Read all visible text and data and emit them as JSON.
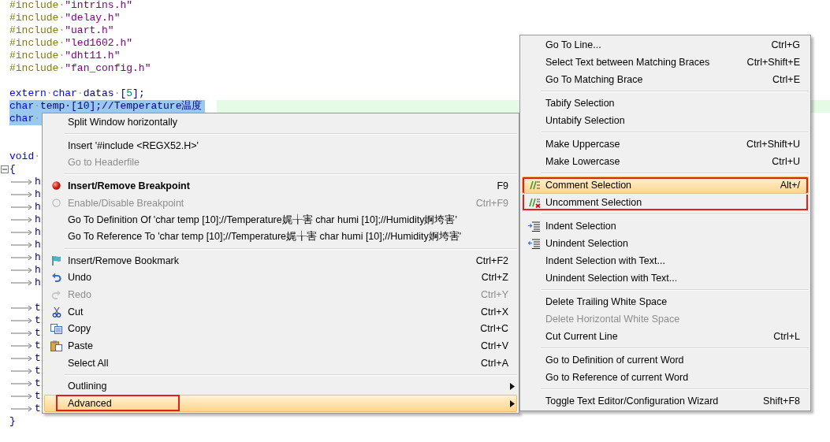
{
  "editor": {
    "lines": [
      {
        "kind": "code",
        "tokens": [
          {
            "kind": "directive",
            "text": "#include"
          },
          {
            "kind": "space",
            "text": "·"
          },
          {
            "kind": "string",
            "text": "\"intrins.h\""
          }
        ]
      },
      {
        "kind": "code",
        "tokens": [
          {
            "kind": "directive",
            "text": "#include"
          },
          {
            "kind": "space",
            "text": "·"
          },
          {
            "kind": "string",
            "text": "\"delay.h\""
          }
        ]
      },
      {
        "kind": "code",
        "tokens": [
          {
            "kind": "directive",
            "text": "#include"
          },
          {
            "kind": "space",
            "text": "·"
          },
          {
            "kind": "string",
            "text": "\"uart.h\""
          }
        ]
      },
      {
        "kind": "code",
        "tokens": [
          {
            "kind": "directive",
            "text": "#include"
          },
          {
            "kind": "space",
            "text": "·"
          },
          {
            "kind": "string",
            "text": "\"led1602.h\""
          }
        ]
      },
      {
        "kind": "code",
        "tokens": [
          {
            "kind": "directive",
            "text": "#include"
          },
          {
            "kind": "space",
            "text": "·"
          },
          {
            "kind": "string",
            "text": "\"dht11.h\""
          }
        ]
      },
      {
        "kind": "code",
        "tokens": [
          {
            "kind": "directive",
            "text": "#include"
          },
          {
            "kind": "space",
            "text": "·"
          },
          {
            "kind": "string",
            "text": "\"fan_config.h\""
          }
        ]
      },
      {
        "kind": "blank"
      },
      {
        "kind": "code",
        "tokens": [
          {
            "kind": "keyword",
            "text": "extern"
          },
          {
            "kind": "space",
            "text": "·"
          },
          {
            "kind": "keyword",
            "text": "char"
          },
          {
            "kind": "space",
            "text": "·"
          },
          {
            "kind": "plain",
            "text": "datas"
          },
          {
            "kind": "space",
            "text": "·"
          },
          {
            "kind": "plain",
            "text": "["
          },
          {
            "kind": "number",
            "text": "5"
          },
          {
            "kind": "plain",
            "text": "];"
          }
        ]
      },
      {
        "kind": "code",
        "selected": true,
        "current": true,
        "tokens": [
          {
            "kind": "keyword",
            "text": "char"
          },
          {
            "kind": "space",
            "text": "·"
          },
          {
            "kind": "plain",
            "text": "temp·[10];//Temperature温度"
          }
        ]
      },
      {
        "kind": "code",
        "selected": true,
        "tokens": [
          {
            "kind": "keyword",
            "text": "char"
          },
          {
            "kind": "space",
            "text": "·"
          }
        ]
      },
      {
        "kind": "blank"
      },
      {
        "kind": "blank"
      },
      {
        "kind": "code",
        "tokens": [
          {
            "kind": "keyword",
            "text": "void"
          },
          {
            "kind": "space",
            "text": "·"
          }
        ]
      },
      {
        "kind": "code",
        "fold_marker": true,
        "tokens": [
          {
            "kind": "plain",
            "text": "{"
          }
        ]
      },
      {
        "kind": "code",
        "tokens": [
          {
            "kind": "tab"
          },
          {
            "kind": "plain",
            "text": "h"
          }
        ]
      },
      {
        "kind": "code",
        "tokens": [
          {
            "kind": "tab"
          },
          {
            "kind": "plain",
            "text": "h"
          }
        ]
      },
      {
        "kind": "code",
        "tokens": [
          {
            "kind": "tab"
          },
          {
            "kind": "plain",
            "text": "h"
          }
        ]
      },
      {
        "kind": "code",
        "tokens": [
          {
            "kind": "tab"
          },
          {
            "kind": "plain",
            "text": "h"
          }
        ]
      },
      {
        "kind": "code",
        "tokens": [
          {
            "kind": "tab"
          },
          {
            "kind": "plain",
            "text": "h"
          }
        ]
      },
      {
        "kind": "code",
        "tokens": [
          {
            "kind": "tab"
          },
          {
            "kind": "plain",
            "text": "h"
          }
        ]
      },
      {
        "kind": "code",
        "tokens": [
          {
            "kind": "tab"
          },
          {
            "kind": "plain",
            "text": "h"
          }
        ]
      },
      {
        "kind": "code",
        "tokens": [
          {
            "kind": "tab"
          },
          {
            "kind": "plain",
            "text": "h"
          }
        ]
      },
      {
        "kind": "code",
        "tokens": [
          {
            "kind": "tab"
          },
          {
            "kind": "plain",
            "text": "h"
          }
        ]
      },
      {
        "kind": "blank"
      },
      {
        "kind": "code",
        "tokens": [
          {
            "kind": "tab"
          },
          {
            "kind": "plain",
            "text": "t"
          }
        ]
      },
      {
        "kind": "code",
        "tokens": [
          {
            "kind": "tab"
          },
          {
            "kind": "plain",
            "text": "t"
          }
        ]
      },
      {
        "kind": "code",
        "tokens": [
          {
            "kind": "tab"
          },
          {
            "kind": "plain",
            "text": "t"
          }
        ]
      },
      {
        "kind": "code",
        "tokens": [
          {
            "kind": "tab"
          },
          {
            "kind": "plain",
            "text": "t"
          }
        ]
      },
      {
        "kind": "code",
        "tokens": [
          {
            "kind": "tab"
          },
          {
            "kind": "plain",
            "text": "t"
          }
        ]
      },
      {
        "kind": "code",
        "tokens": [
          {
            "kind": "tab"
          },
          {
            "kind": "plain",
            "text": "t"
          }
        ]
      },
      {
        "kind": "code",
        "tokens": [
          {
            "kind": "tab"
          },
          {
            "kind": "plain",
            "text": "t"
          }
        ]
      },
      {
        "kind": "code",
        "tokens": [
          {
            "kind": "tab"
          },
          {
            "kind": "plain",
            "text": "t"
          }
        ]
      },
      {
        "kind": "code",
        "tokens": [
          {
            "kind": "tab"
          },
          {
            "kind": "plain",
            "text": "t"
          }
        ]
      },
      {
        "kind": "code",
        "tokens": [
          {
            "kind": "plain",
            "text": "}"
          }
        ]
      }
    ]
  },
  "context_menu": {
    "items": [
      {
        "kind": "item",
        "label": "Split Window horizontally",
        "selected": false
      },
      {
        "kind": "separator"
      },
      {
        "kind": "item",
        "label": "Insert '#include <REGX52.H>'",
        "selected": false
      },
      {
        "kind": "item",
        "label": "Go to Headerfile",
        "disabled": true,
        "selected": false
      },
      {
        "kind": "separator"
      },
      {
        "kind": "breakpoint",
        "label": "Insert/Remove Breakpoint",
        "shortcut": "F9",
        "bold": true,
        "selected": false
      },
      {
        "kind": "breakpoint",
        "label": "Enable/Disable Breakpoint",
        "shortcut": "Ctrl+F9",
        "disabled": true,
        "selected": false
      },
      {
        "kind": "item",
        "label": "Go To Definition Of 'char temp [10];//Temperature娓╁害 char humi [10];//Humidity婀垮害'",
        "selected": false
      },
      {
        "kind": "item",
        "label": "Go To Reference To 'char temp [10];//Temperature娓╁害 char humi [10];//Humidity婀垮害'",
        "selected": false
      },
      {
        "kind": "separator"
      },
      {
        "kind": "bookmark",
        "label": "Insert/Remove Bookmark",
        "shortcut": "Ctrl+F2",
        "selected": false
      },
      {
        "kind": "undo",
        "label": "Undo",
        "shortcut": "Ctrl+Z",
        "selected": false
      },
      {
        "kind": "redo",
        "label": "Redo",
        "shortcut": "Ctrl+Y",
        "disabled": true,
        "selected": false
      },
      {
        "kind": "cut",
        "label": "Cut",
        "shortcut": "Ctrl+X",
        "selected": false
      },
      {
        "kind": "copy",
        "label": "Copy",
        "shortcut": "Ctrl+C",
        "selected": false
      },
      {
        "kind": "paste",
        "label": "Paste",
        "shortcut": "Ctrl+V",
        "selected": false
      },
      {
        "kind": "item",
        "label": "Select All",
        "shortcut": "Ctrl+A",
        "selected": false
      },
      {
        "kind": "separator"
      },
      {
        "kind": "item",
        "label": "Outlining",
        "submenu": true,
        "selected": false
      },
      {
        "kind": "item",
        "label": "Advanced",
        "submenu": true,
        "selected": true,
        "marked": true
      }
    ]
  },
  "submenu": {
    "items": [
      {
        "kind": "item",
        "label": "Go To Line...",
        "shortcut": "Ctrl+G",
        "selected": false
      },
      {
        "kind": "item",
        "label": "Select Text between Matching Braces",
        "shortcut": "Ctrl+Shift+E",
        "selected": false
      },
      {
        "kind": "item",
        "label": "Go To Matching Brace",
        "shortcut": "Ctrl+E",
        "selected": false
      },
      {
        "kind": "separator"
      },
      {
        "kind": "item",
        "label": "Tabify Selection",
        "selected": false
      },
      {
        "kind": "item",
        "label": "Untabify Selection",
        "selected": false
      },
      {
        "kind": "separator"
      },
      {
        "kind": "item",
        "label": "Make Uppercase",
        "shortcut": "Ctrl+Shift+U",
        "selected": false
      },
      {
        "kind": "item",
        "label": "Make Lowercase",
        "shortcut": "Ctrl+U",
        "selected": false
      },
      {
        "kind": "separator"
      },
      {
        "kind": "comment",
        "label": "Comment Selection",
        "shortcut": "Alt+/",
        "selected": true,
        "marked": true
      },
      {
        "kind": "uncomment",
        "label": "Uncomment Selection",
        "selected": false,
        "marked": true
      },
      {
        "kind": "separator"
      },
      {
        "kind": "indent",
        "label": "Indent Selection",
        "selected": false
      },
      {
        "kind": "unindent",
        "label": "Unindent Selection",
        "selected": false
      },
      {
        "kind": "item",
        "label": "Indent Selection with Text...",
        "selected": false
      },
      {
        "kind": "item",
        "label": "Unindent Selection with Text...",
        "selected": false
      },
      {
        "kind": "separator"
      },
      {
        "kind": "item",
        "label": "Delete Trailing White Space",
        "selected": false
      },
      {
        "kind": "item",
        "label": "Delete Horizontal White Space",
        "disabled": true,
        "selected": false
      },
      {
        "kind": "item",
        "label": "Cut Current Line",
        "shortcut": "Ctrl+L",
        "selected": false
      },
      {
        "kind": "separator"
      },
      {
        "kind": "item",
        "label": "Go to Definition of current Word",
        "selected": false
      },
      {
        "kind": "item",
        "label": "Go to Reference of current Word",
        "selected": false
      },
      {
        "kind": "separator"
      },
      {
        "kind": "item",
        "label": "Toggle Text Editor/Configuration Wizard",
        "shortcut": "Shift+F8",
        "selected": false
      }
    ]
  }
}
